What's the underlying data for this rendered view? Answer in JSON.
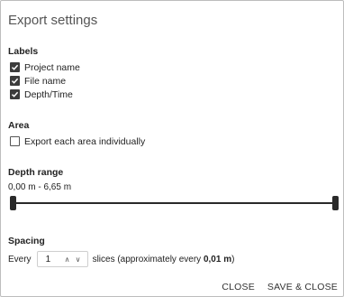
{
  "dialog": {
    "title": "Export settings",
    "labels": {
      "heading": "Labels",
      "items": [
        {
          "label": "Project name",
          "checked": true
        },
        {
          "label": "File name",
          "checked": true
        },
        {
          "label": "Depth/Time",
          "checked": true
        }
      ]
    },
    "area": {
      "heading": "Area",
      "option": {
        "label": "Export each area individually",
        "checked": false
      }
    },
    "depth_range": {
      "heading": "Depth range",
      "value_text": "0,00 m - 6,65 m",
      "min": "0,00 m",
      "max": "6,65 m"
    },
    "spacing": {
      "heading": "Spacing",
      "prefix": "Every",
      "value": "1",
      "suffix_before": "slices (approximately every",
      "suffix_bold": "0,01 m",
      "suffix_after": ")"
    },
    "buttons": {
      "close": "CLOSE",
      "save_close": "SAVE & CLOSE"
    },
    "colors": {
      "checked_box": "#3c3c3c",
      "slider": "#2a2a2a",
      "border": "#bdbdbd"
    }
  }
}
